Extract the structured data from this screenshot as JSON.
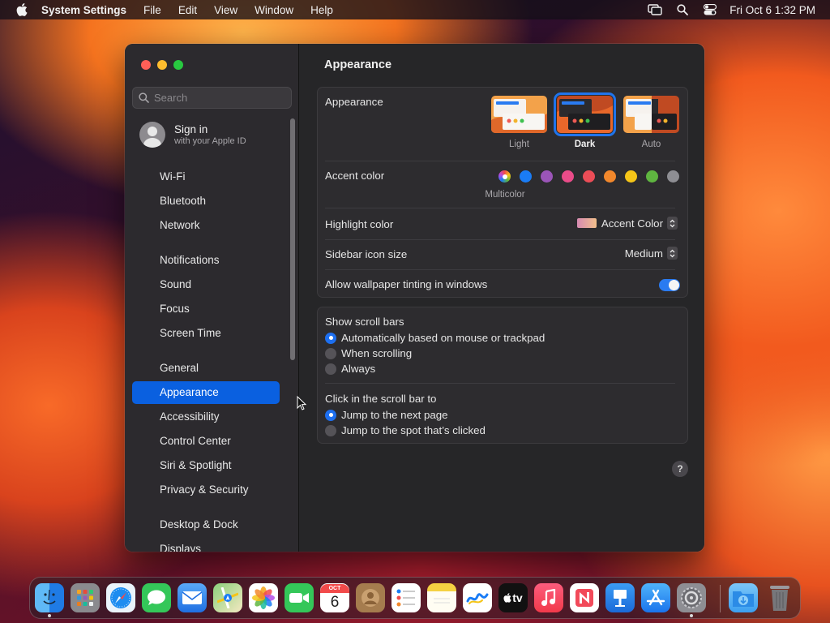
{
  "menubar": {
    "app_name": "System Settings",
    "menus": [
      "File",
      "Edit",
      "View",
      "Window",
      "Help"
    ],
    "clock": "Fri Oct 6  1:32 PM"
  },
  "sidebar": {
    "search_placeholder": "Search",
    "signin_title": "Sign in",
    "signin_subtitle": "with your Apple ID",
    "items": [
      {
        "label": "Wi-Fi",
        "icon": "wifi-icon",
        "color": "#1a7cf5"
      },
      {
        "label": "Bluetooth",
        "icon": "bluetooth-icon",
        "color": "#1a7cf5"
      },
      {
        "label": "Network",
        "icon": "globe-icon",
        "color": "#1a7cf5"
      },
      {
        "label": "Notifications",
        "icon": "bell-icon",
        "color": "#f04040"
      },
      {
        "label": "Sound",
        "icon": "speaker-icon",
        "color": "#f0407a"
      },
      {
        "label": "Focus",
        "icon": "moon-icon",
        "color": "#5e5ce6"
      },
      {
        "label": "Screen Time",
        "icon": "hourglass-icon",
        "color": "#5e5ce6"
      },
      {
        "label": "General",
        "icon": "gear-icon",
        "color": "#8e8e93"
      },
      {
        "label": "Appearance",
        "icon": "appearance-icon",
        "color": "#1c1c1e"
      },
      {
        "label": "Accessibility",
        "icon": "accessibility-icon",
        "color": "#1a7cf5"
      },
      {
        "label": "Control Center",
        "icon": "control-center-icon",
        "color": "#8e8e93"
      },
      {
        "label": "Siri & Spotlight",
        "icon": "siri-icon",
        "color": "#b44ae6"
      },
      {
        "label": "Privacy & Security",
        "icon": "hand-icon",
        "color": "#1a7cf5"
      },
      {
        "label": "Desktop & Dock",
        "icon": "dock-icon",
        "color": "#1c1c1e"
      },
      {
        "label": "Displays",
        "icon": "display-icon",
        "color": "#1a7cf5"
      }
    ],
    "selected": "Appearance"
  },
  "content": {
    "title": "Appearance",
    "appearance_label": "Appearance",
    "appearance_options": [
      "Light",
      "Dark",
      "Auto"
    ],
    "appearance_selected": "Dark",
    "accent_label": "Accent color",
    "accent_colors": [
      "#c04fe0",
      "#1a7cf5",
      "#9b55b8",
      "#ea4c89",
      "#ec4d57",
      "#f2882c",
      "#f5c518",
      "#5fb540",
      "#8e8e93"
    ],
    "accent_selected_caption": "Multicolor",
    "highlight_label": "Highlight color",
    "highlight_value": "Accent Color",
    "icon_size_label": "Sidebar icon size",
    "icon_size_value": "Medium",
    "tinting_label": "Allow wallpaper tinting in windows",
    "tinting_on": true,
    "scroll_bars_label": "Show scroll bars",
    "scroll_bars_options": [
      "Automatically based on mouse or trackpad",
      "When scrolling",
      "Always"
    ],
    "scroll_bars_selected": "Automatically based on mouse or trackpad",
    "click_label": "Click in the scroll bar to",
    "click_options": [
      "Jump to the next page",
      "Jump to the spot that’s clicked"
    ],
    "click_selected": "Jump to the next page",
    "help_glyph": "?"
  },
  "dock": {
    "apps": [
      "Finder",
      "Launchpad",
      "Safari",
      "Messages",
      "Mail",
      "Maps",
      "Photos",
      "FaceTime",
      "Calendar",
      "Contacts",
      "Reminders",
      "Notes",
      "Freeform",
      "TV",
      "Music",
      "News",
      "Keynote",
      "App Store",
      "System Settings",
      "Downloads",
      "Trash"
    ],
    "calendar_month": "OCT",
    "calendar_day": "6",
    "tv_label": "tv"
  }
}
